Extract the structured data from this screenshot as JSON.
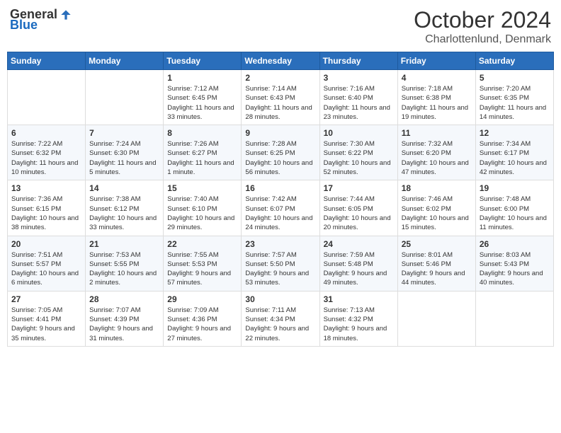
{
  "header": {
    "logo_general": "General",
    "logo_blue": "Blue",
    "month": "October 2024",
    "location": "Charlottenlund, Denmark"
  },
  "weekdays": [
    "Sunday",
    "Monday",
    "Tuesday",
    "Wednesday",
    "Thursday",
    "Friday",
    "Saturday"
  ],
  "weeks": [
    [
      {
        "day": "",
        "info": ""
      },
      {
        "day": "",
        "info": ""
      },
      {
        "day": "1",
        "info": "Sunrise: 7:12 AM\nSunset: 6:45 PM\nDaylight: 11 hours and 33 minutes."
      },
      {
        "day": "2",
        "info": "Sunrise: 7:14 AM\nSunset: 6:43 PM\nDaylight: 11 hours and 28 minutes."
      },
      {
        "day": "3",
        "info": "Sunrise: 7:16 AM\nSunset: 6:40 PM\nDaylight: 11 hours and 23 minutes."
      },
      {
        "day": "4",
        "info": "Sunrise: 7:18 AM\nSunset: 6:38 PM\nDaylight: 11 hours and 19 minutes."
      },
      {
        "day": "5",
        "info": "Sunrise: 7:20 AM\nSunset: 6:35 PM\nDaylight: 11 hours and 14 minutes."
      }
    ],
    [
      {
        "day": "6",
        "info": "Sunrise: 7:22 AM\nSunset: 6:32 PM\nDaylight: 11 hours and 10 minutes."
      },
      {
        "day": "7",
        "info": "Sunrise: 7:24 AM\nSunset: 6:30 PM\nDaylight: 11 hours and 5 minutes."
      },
      {
        "day": "8",
        "info": "Sunrise: 7:26 AM\nSunset: 6:27 PM\nDaylight: 11 hours and 1 minute."
      },
      {
        "day": "9",
        "info": "Sunrise: 7:28 AM\nSunset: 6:25 PM\nDaylight: 10 hours and 56 minutes."
      },
      {
        "day": "10",
        "info": "Sunrise: 7:30 AM\nSunset: 6:22 PM\nDaylight: 10 hours and 52 minutes."
      },
      {
        "day": "11",
        "info": "Sunrise: 7:32 AM\nSunset: 6:20 PM\nDaylight: 10 hours and 47 minutes."
      },
      {
        "day": "12",
        "info": "Sunrise: 7:34 AM\nSunset: 6:17 PM\nDaylight: 10 hours and 42 minutes."
      }
    ],
    [
      {
        "day": "13",
        "info": "Sunrise: 7:36 AM\nSunset: 6:15 PM\nDaylight: 10 hours and 38 minutes."
      },
      {
        "day": "14",
        "info": "Sunrise: 7:38 AM\nSunset: 6:12 PM\nDaylight: 10 hours and 33 minutes."
      },
      {
        "day": "15",
        "info": "Sunrise: 7:40 AM\nSunset: 6:10 PM\nDaylight: 10 hours and 29 minutes."
      },
      {
        "day": "16",
        "info": "Sunrise: 7:42 AM\nSunset: 6:07 PM\nDaylight: 10 hours and 24 minutes."
      },
      {
        "day": "17",
        "info": "Sunrise: 7:44 AM\nSunset: 6:05 PM\nDaylight: 10 hours and 20 minutes."
      },
      {
        "day": "18",
        "info": "Sunrise: 7:46 AM\nSunset: 6:02 PM\nDaylight: 10 hours and 15 minutes."
      },
      {
        "day": "19",
        "info": "Sunrise: 7:48 AM\nSunset: 6:00 PM\nDaylight: 10 hours and 11 minutes."
      }
    ],
    [
      {
        "day": "20",
        "info": "Sunrise: 7:51 AM\nSunset: 5:57 PM\nDaylight: 10 hours and 6 minutes."
      },
      {
        "day": "21",
        "info": "Sunrise: 7:53 AM\nSunset: 5:55 PM\nDaylight: 10 hours and 2 minutes."
      },
      {
        "day": "22",
        "info": "Sunrise: 7:55 AM\nSunset: 5:53 PM\nDaylight: 9 hours and 57 minutes."
      },
      {
        "day": "23",
        "info": "Sunrise: 7:57 AM\nSunset: 5:50 PM\nDaylight: 9 hours and 53 minutes."
      },
      {
        "day": "24",
        "info": "Sunrise: 7:59 AM\nSunset: 5:48 PM\nDaylight: 9 hours and 49 minutes."
      },
      {
        "day": "25",
        "info": "Sunrise: 8:01 AM\nSunset: 5:46 PM\nDaylight: 9 hours and 44 minutes."
      },
      {
        "day": "26",
        "info": "Sunrise: 8:03 AM\nSunset: 5:43 PM\nDaylight: 9 hours and 40 minutes."
      }
    ],
    [
      {
        "day": "27",
        "info": "Sunrise: 7:05 AM\nSunset: 4:41 PM\nDaylight: 9 hours and 35 minutes."
      },
      {
        "day": "28",
        "info": "Sunrise: 7:07 AM\nSunset: 4:39 PM\nDaylight: 9 hours and 31 minutes."
      },
      {
        "day": "29",
        "info": "Sunrise: 7:09 AM\nSunset: 4:36 PM\nDaylight: 9 hours and 27 minutes."
      },
      {
        "day": "30",
        "info": "Sunrise: 7:11 AM\nSunset: 4:34 PM\nDaylight: 9 hours and 22 minutes."
      },
      {
        "day": "31",
        "info": "Sunrise: 7:13 AM\nSunset: 4:32 PM\nDaylight: 9 hours and 18 minutes."
      },
      {
        "day": "",
        "info": ""
      },
      {
        "day": "",
        "info": ""
      }
    ]
  ]
}
